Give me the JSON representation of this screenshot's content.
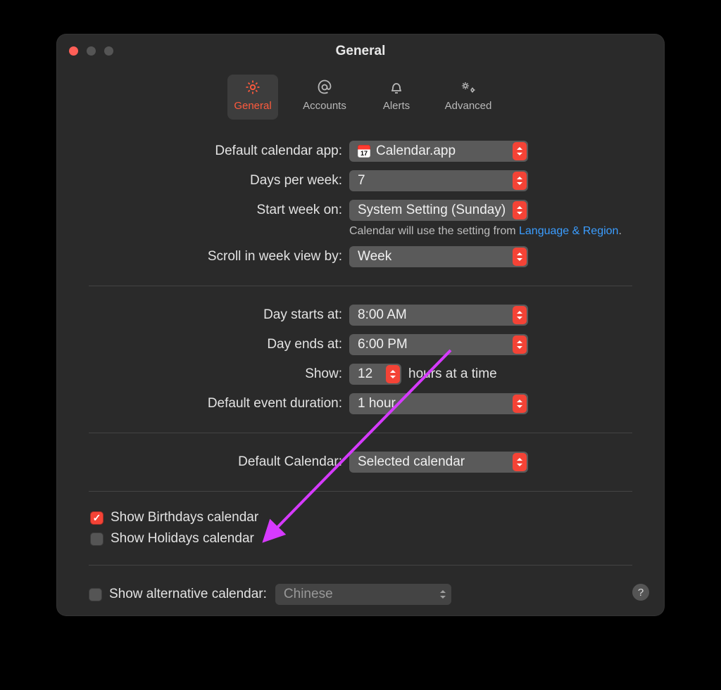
{
  "window": {
    "title": "General"
  },
  "toolbar": {
    "items": [
      {
        "label": "General",
        "selected": true
      },
      {
        "label": "Accounts",
        "selected": false
      },
      {
        "label": "Alerts",
        "selected": false
      },
      {
        "label": "Advanced",
        "selected": false
      }
    ]
  },
  "settings": {
    "default_app": {
      "label": "Default calendar app:",
      "value": "Calendar.app"
    },
    "days_per_week": {
      "label": "Days per week:",
      "value": "7"
    },
    "start_week_on": {
      "label": "Start week on:",
      "value": "System Setting (Sunday)"
    },
    "start_week_hint_pre": "Calendar will use the setting from ",
    "start_week_hint_link": "Language & Region",
    "start_week_hint_post": ".",
    "scroll_week": {
      "label": "Scroll in week view by:",
      "value": "Week"
    },
    "day_starts": {
      "label": "Day starts at:",
      "value": "8:00 AM"
    },
    "day_ends": {
      "label": "Day ends at:",
      "value": "6:00 PM"
    },
    "show_hours": {
      "label": "Show:",
      "value": "12",
      "suffix": "hours at a time"
    },
    "default_duration": {
      "label": "Default event duration:",
      "value": "1 hour"
    },
    "default_calendar": {
      "label": "Default Calendar:",
      "value": "Selected calendar"
    }
  },
  "checkboxes": {
    "birthdays": {
      "label": "Show Birthdays calendar",
      "checked": true
    },
    "holidays": {
      "label": "Show Holidays calendar",
      "checked": false
    }
  },
  "alt_calendar": {
    "label": "Show alternative calendar:",
    "value": "Chinese",
    "checked": false
  },
  "help_tooltip": "?",
  "annotation": {
    "arrow_color": "#d63aff"
  }
}
